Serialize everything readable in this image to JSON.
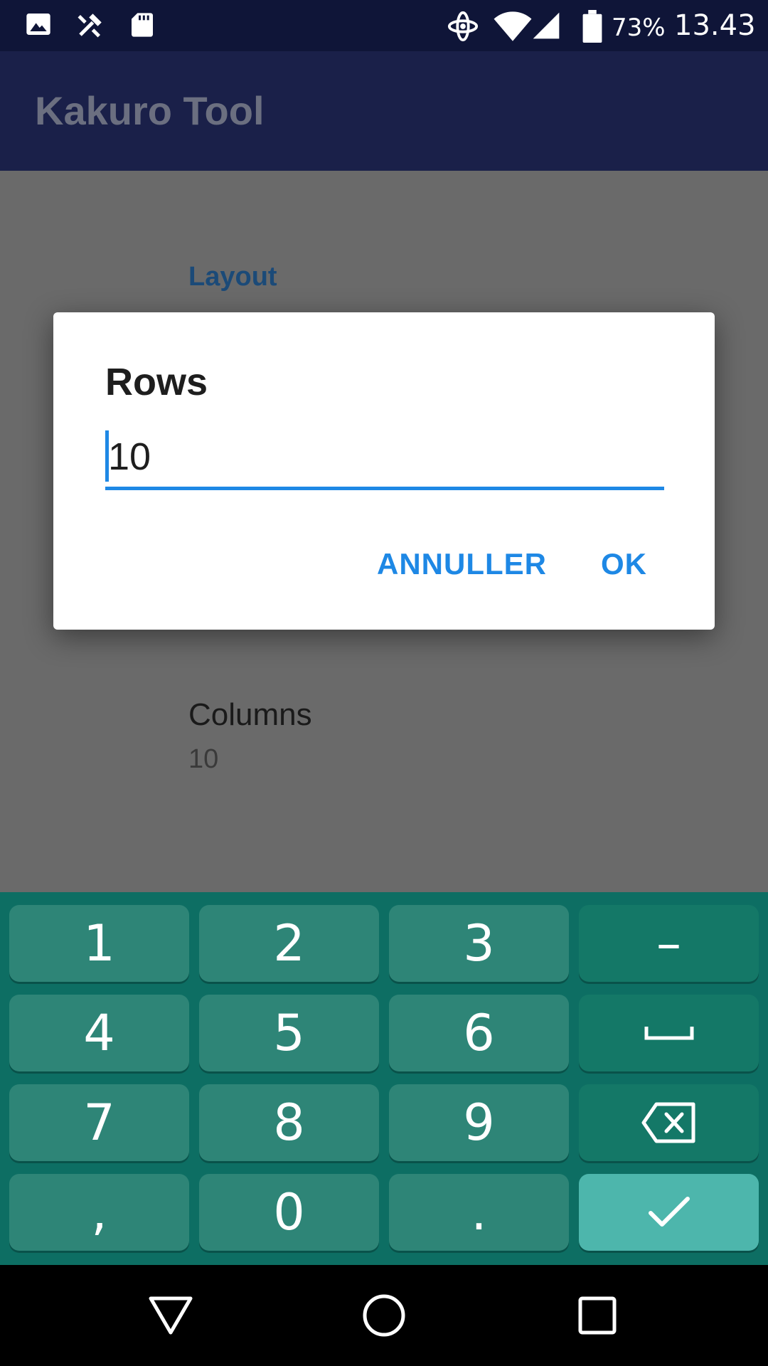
{
  "status_bar": {
    "battery_percent": "73%",
    "time": "13.43",
    "icons": [
      "image-icon",
      "tools-icon",
      "sd-card-icon",
      "sync-icon",
      "wifi-icon",
      "signal-icon",
      "battery-icon"
    ]
  },
  "app_bar": {
    "title": "Kakuro Tool"
  },
  "settings": {
    "section_header": "Layout",
    "columns": {
      "title": "Columns",
      "summary": "10"
    }
  },
  "dialog": {
    "title": "Rows",
    "input_value": "10",
    "cancel_label": "ANNULLER",
    "ok_label": "OK",
    "accent_color": "#1e88e5"
  },
  "keyboard": {
    "rows": [
      [
        "1",
        "2",
        "3",
        "–"
      ],
      [
        "4",
        "5",
        "6",
        "space"
      ],
      [
        "7",
        "8",
        "9",
        "backspace"
      ],
      [
        ",",
        "0",
        ".",
        "enter"
      ]
    ],
    "labels": {
      "k1": "1",
      "k2": "2",
      "k3": "3",
      "minus": "–",
      "k4": "4",
      "k5": "5",
      "k6": "6",
      "k7": "7",
      "k8": "8",
      "k9": "9",
      "comma": ",",
      "k0": "0",
      "period": "."
    }
  },
  "nav_bar": {
    "icons": [
      "back-icon",
      "home-icon",
      "recents-icon"
    ]
  }
}
